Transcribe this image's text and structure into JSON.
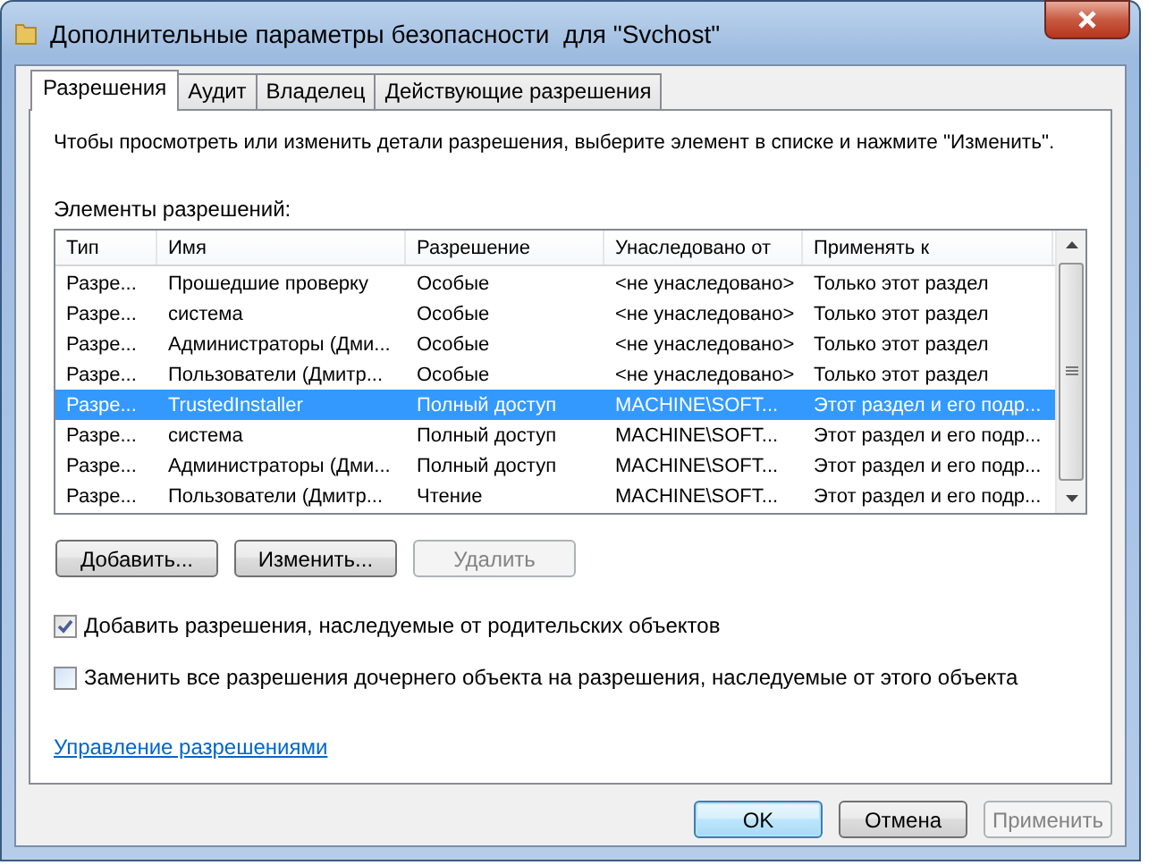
{
  "window": {
    "title": "Дополнительные параметры безопасности  для \"Svchost\""
  },
  "tabs": [
    {
      "label": "Разрешения",
      "selected": true
    },
    {
      "label": "Аудит",
      "selected": false
    },
    {
      "label": "Владелец",
      "selected": false
    },
    {
      "label": "Действующие разрешения",
      "selected": false
    }
  ],
  "instruction": "Чтобы просмотреть или изменить детали разрешения, выберите элемент в списке и нажмите \"Изменить\".",
  "list_label": "Элементы разрешений:",
  "table": {
    "columns": [
      "Тип",
      "Имя",
      "Разрешение",
      "Унаследовано от",
      "Применять к"
    ],
    "rows": [
      {
        "cells": [
          "Разре...",
          "Прошедшие проверку",
          "Особые",
          "<не унаследовано>",
          "Только этот раздел"
        ],
        "selected": false
      },
      {
        "cells": [
          "Разре...",
          "система",
          "Особые",
          "<не унаследовано>",
          "Только этот раздел"
        ],
        "selected": false
      },
      {
        "cells": [
          "Разре...",
          "Администраторы (Дми...",
          "Особые",
          "<не унаследовано>",
          "Только этот раздел"
        ],
        "selected": false
      },
      {
        "cells": [
          "Разре...",
          "Пользователи (Дмитр...",
          "Особые",
          "<не унаследовано>",
          "Только этот раздел"
        ],
        "selected": false
      },
      {
        "cells": [
          "Разре...",
          "TrustedInstaller",
          "Полный доступ",
          "MACHINE\\SOFT...",
          "Этот раздел и его подр..."
        ],
        "selected": true
      },
      {
        "cells": [
          "Разре...",
          "система",
          "Полный доступ",
          "MACHINE\\SOFT...",
          "Этот раздел и его подр..."
        ],
        "selected": false
      },
      {
        "cells": [
          "Разре...",
          "Администраторы (Дми...",
          "Полный доступ",
          "MACHINE\\SOFT...",
          "Этот раздел и его подр..."
        ],
        "selected": false
      },
      {
        "cells": [
          "Разре...",
          "Пользователи (Дмитр...",
          "Чтение",
          "MACHINE\\SOFT...",
          "Этот раздел и его подр..."
        ],
        "selected": false
      }
    ]
  },
  "list_buttons": [
    {
      "label": "Добавить...",
      "disabled": false
    },
    {
      "label": "Изменить...",
      "disabled": false
    },
    {
      "label": "Удалить",
      "disabled": true
    }
  ],
  "checkboxes": [
    {
      "label": "Добавить разрешения, наследуемые от родительских объектов",
      "checked": true
    },
    {
      "label": "Заменить все разрешения дочернего объекта на разрешения, наследуемые от этого объекта",
      "checked": false
    }
  ],
  "link": "Управление разрешениями",
  "footer_buttons": [
    {
      "label": "OK",
      "disabled": false,
      "default": true
    },
    {
      "label": "Отмена",
      "disabled": false,
      "default": false
    },
    {
      "label": "Применить",
      "disabled": true,
      "default": false
    }
  ]
}
